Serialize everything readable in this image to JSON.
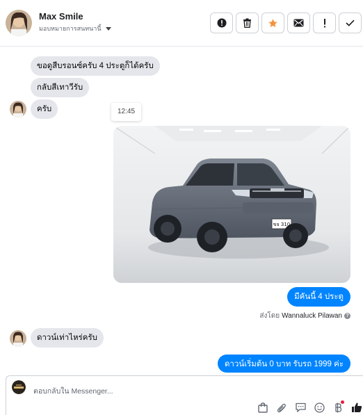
{
  "header": {
    "contact_name": "Max Smile",
    "status_label": "มอบหมายการสนทนานี้"
  },
  "actions": [
    {
      "id": "alert",
      "icon": "alert-circle-icon"
    },
    {
      "id": "delete",
      "icon": "trash-icon"
    },
    {
      "id": "star",
      "icon": "star-icon",
      "color": "#f7923a"
    },
    {
      "id": "mail",
      "icon": "mail-icon"
    },
    {
      "id": "important",
      "icon": "exclamation-icon"
    },
    {
      "id": "done",
      "icon": "check-icon"
    }
  ],
  "messages": {
    "m1": "ขอดูสีบรอนซ์ครับ 4 ประตูก็ได้ครับ",
    "m2": "กลับสีเทาวีรับ",
    "m3": "ครับ",
    "timestamp": "12:45",
    "out1": "มีคันนี้  4 ประตู",
    "sent_by_label": "ส่งโดย",
    "sent_by_name": "Wannaluck Pilawan",
    "m4": "ดาวน์เท่าไหร่ครับ",
    "out2": "ดาวน์เริ่มต้น 0 บาท รับรถ 1999 ค่ะ"
  },
  "photo": {
    "plate": "ขจ 310"
  },
  "composer": {
    "placeholder": "ตอบกลับใน Messenger..."
  },
  "colors": {
    "accent": "#0084ff",
    "incoming_bubble": "#e4e6eb",
    "star": "#f7923a"
  }
}
